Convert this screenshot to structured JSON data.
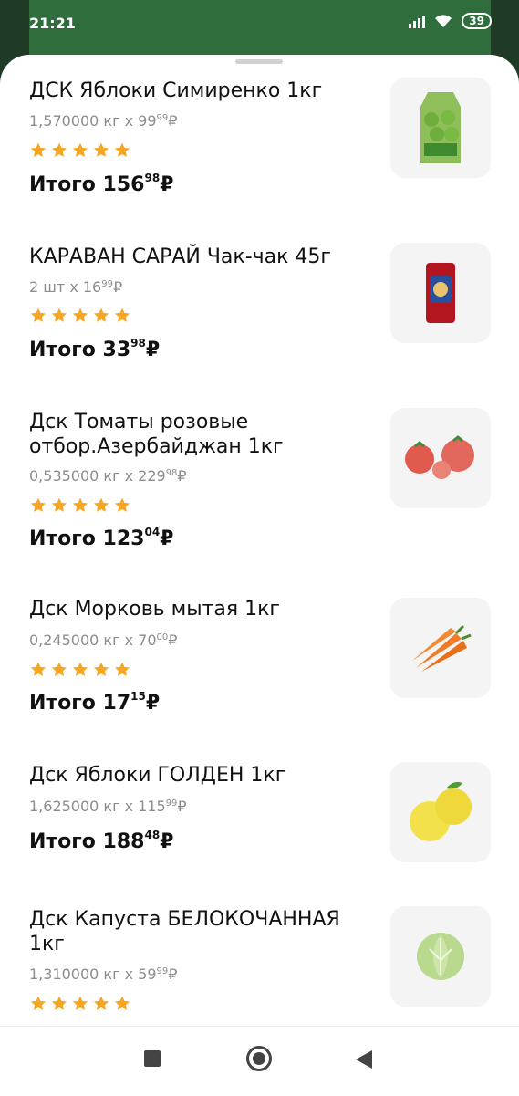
{
  "status_bar": {
    "time": "21:21",
    "battery": "39"
  },
  "items": [
    {
      "title": "ДСК Яблоки Симиренко 1кг",
      "qty_prefix": "1,570000 кг x 99",
      "qty_cents": "99",
      "currency": "₽",
      "rating": 5,
      "total_label": "Итого 156",
      "total_cents": "98",
      "image": "green-apples-bag"
    },
    {
      "title": "КАРАВАН САРАЙ Чак-чак 45г",
      "qty_prefix": "2 шт x 16",
      "qty_cents": "99",
      "currency": "₽",
      "rating": 5,
      "total_label": "Итого 33",
      "total_cents": "98",
      "image": "chak-chak-pack"
    },
    {
      "title": "Дск Томаты розовые отбор.Азербайджан 1кг",
      "qty_prefix": "0,535000 кг x 229",
      "qty_cents": "98",
      "currency": "₽",
      "rating": 5,
      "total_label": "Итого 123",
      "total_cents": "04",
      "image": "tomatoes"
    },
    {
      "title": "Дск Морковь мытая 1кг",
      "qty_prefix": "0,245000 кг x 70",
      "qty_cents": "00",
      "currency": "₽",
      "rating": 5,
      "total_label": "Итого 17",
      "total_cents": "15",
      "image": "carrots"
    },
    {
      "title": "Дск Яблоки ГОЛДЕН 1кг",
      "qty_prefix": "1,625000 кг x 115",
      "qty_cents": "99",
      "currency": "₽",
      "rating": 0,
      "total_label": "Итого 188",
      "total_cents": "48",
      "image": "yellow-apples"
    },
    {
      "title": "Дск Капуста БЕЛОКОЧАННАЯ 1кг",
      "qty_prefix": "1,310000 кг x 59",
      "qty_cents": "99",
      "currency": "₽",
      "rating": 5,
      "total_label": "",
      "total_cents": "",
      "image": "cabbage"
    }
  ],
  "total_currency": "₽",
  "colors": {
    "star": "#F5A623",
    "text": "#111111",
    "muted": "#8C8C8C"
  }
}
